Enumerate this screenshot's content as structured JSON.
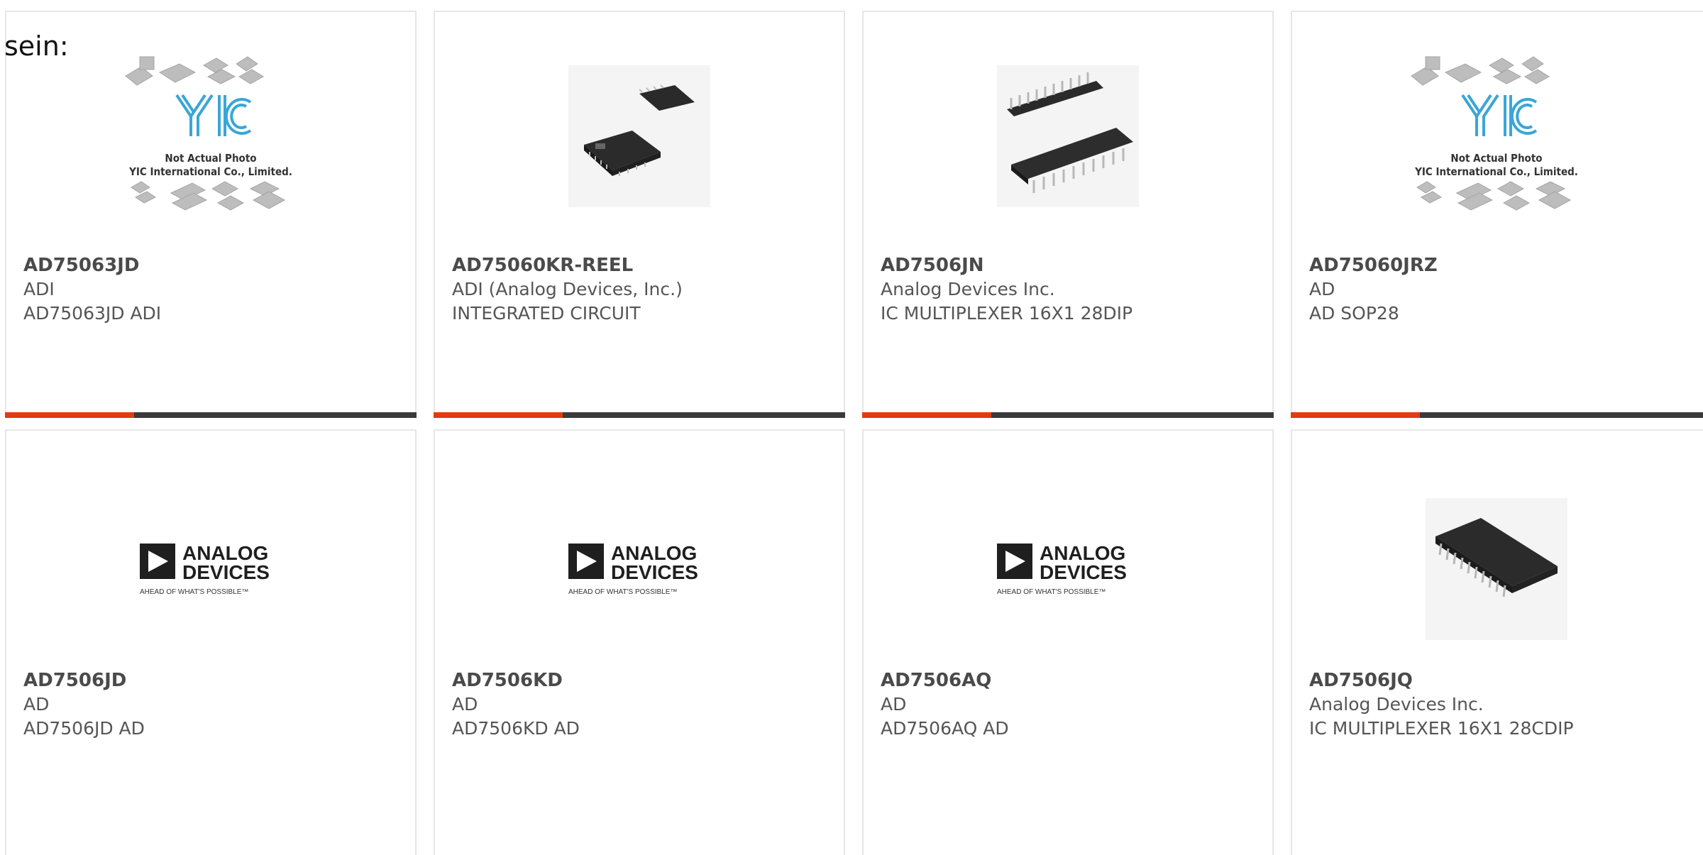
{
  "overlay_text": "sein:",
  "colors": {
    "accent": "#e23b12",
    "bar": "#3a3a3a",
    "border": "#e6e6e6",
    "text": "#555555"
  },
  "placeholder": {
    "logo_text": "YIC",
    "caption_line1": "Not Actual Photo",
    "caption_line2": "YIC International Co., Limited."
  },
  "analog_logo": {
    "line1": "ANALOG",
    "line2": "DEVICES",
    "tagline": "AHEAD OF WHAT'S POSSIBLE™"
  },
  "products": [
    {
      "part": "AD75063JD",
      "maker": "ADI",
      "desc": "AD75063JD ADI",
      "image": "not-actual-photo"
    },
    {
      "part": "AD75060KR-REEL",
      "maker": "ADI (Analog Devices, Inc.)",
      "desc": "INTEGRATED CIRCUIT",
      "image": "plcc-chip-photo"
    },
    {
      "part": "AD7506JN",
      "maker": "Analog Devices Inc.",
      "desc": "IC MULTIPLEXER 16X1 28DIP",
      "image": "dip-chip-photo"
    },
    {
      "part": "AD75060JRZ",
      "maker": "AD",
      "desc": "AD SOP28",
      "image": "not-actual-photo"
    },
    {
      "part": "AD7506JD",
      "maker": "AD",
      "desc": "AD7506JD AD",
      "image": "analog-devices-logo"
    },
    {
      "part": "AD7506KD",
      "maker": "AD",
      "desc": "AD7506KD AD",
      "image": "analog-devices-logo"
    },
    {
      "part": "AD7506AQ",
      "maker": "AD",
      "desc": "AD7506AQ AD",
      "image": "analog-devices-logo"
    },
    {
      "part": "AD7506JQ",
      "maker": "Analog Devices Inc.",
      "desc": "IC MULTIPLEXER 16X1 28CDIP",
      "image": "cdip-chip-photo"
    }
  ]
}
